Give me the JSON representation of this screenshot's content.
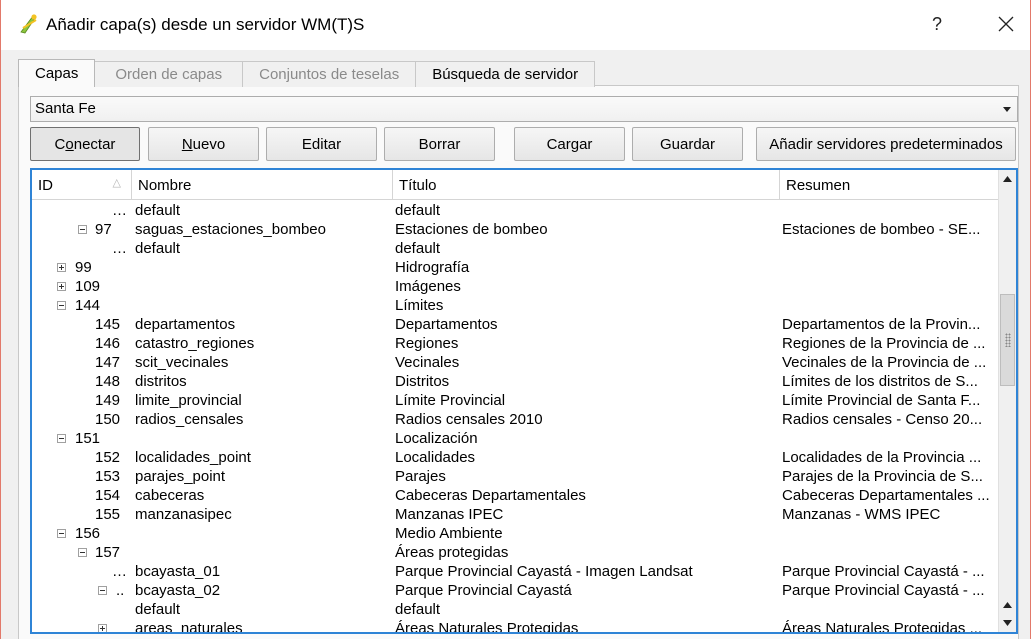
{
  "window": {
    "title": "Añadir capa(s) desde un servidor WM(T)S",
    "help_label": "?"
  },
  "tabs": [
    {
      "label": "Capas",
      "active": true
    },
    {
      "label": "Orden de capas",
      "active": false
    },
    {
      "label": "Conjuntos de teselas",
      "active": false
    },
    {
      "label": "Búsqueda de servidor",
      "active": false
    }
  ],
  "connection": {
    "selected": "Santa Fe"
  },
  "buttons": {
    "connect_pre": "C",
    "connect_u": "o",
    "connect_post": "nectar",
    "new_u": "N",
    "new_post": "uevo",
    "edit": "Editar",
    "delete": "Borrar",
    "load": "Cargar",
    "save": "Guardar",
    "add_defaults": "Añadir servidores predeterminados"
  },
  "table": {
    "columns": [
      "ID",
      "Nombre",
      "Título",
      "Resumen"
    ],
    "sort_indicator": "△",
    "rows": [
      {
        "id": "",
        "name": "default",
        "title": "default",
        "summary": ""
      },
      {
        "id": "97",
        "name": "saguas_estaciones_bombeo",
        "title": "Estaciones de bombeo",
        "summary": "Estaciones de bombeo - SE..."
      },
      {
        "id": "",
        "name": "default",
        "title": "default",
        "summary": ""
      },
      {
        "id": "99",
        "name": "",
        "title": "Hidrografía",
        "summary": ""
      },
      {
        "id": "109",
        "name": "",
        "title": "Imágenes",
        "summary": ""
      },
      {
        "id": "144",
        "name": "",
        "title": "Límites",
        "summary": ""
      },
      {
        "id": "145",
        "name": "departamentos",
        "title": "Departamentos",
        "summary": "Departamentos de la Provin..."
      },
      {
        "id": "146",
        "name": "catastro_regiones",
        "title": "Regiones",
        "summary": "Regiones de la Provincia de ..."
      },
      {
        "id": "147",
        "name": "scit_vecinales",
        "title": "Vecinales",
        "summary": "Vecinales de la Provincia de ..."
      },
      {
        "id": "148",
        "name": "distritos",
        "title": "Distritos",
        "summary": "Límites de los distritos de S..."
      },
      {
        "id": "149",
        "name": "limite_provincial",
        "title": "Límite Provincial",
        "summary": "Límite Provincial de Santa F..."
      },
      {
        "id": "150",
        "name": "radios_censales",
        "title": "Radios censales 2010",
        "summary": "Radios censales - Censo 20..."
      },
      {
        "id": "151",
        "name": "",
        "title": "Localización",
        "summary": ""
      },
      {
        "id": "152",
        "name": "localidades_point",
        "title": "Localidades",
        "summary": "Localidades de la Provincia ..."
      },
      {
        "id": "153",
        "name": "parajes_point",
        "title": "Parajes",
        "summary": "Parajes de la Provincia de S..."
      },
      {
        "id": "154",
        "name": "cabeceras",
        "title": "Cabeceras Departamentales",
        "summary": "Cabeceras Departamentales ..."
      },
      {
        "id": "155",
        "name": "manzanasipec",
        "title": "Manzanas IPEC",
        "summary": "Manzanas - WMS IPEC"
      },
      {
        "id": "156",
        "name": "",
        "title": "Medio Ambiente",
        "summary": ""
      },
      {
        "id": "157",
        "name": "",
        "title": "Áreas protegidas",
        "summary": ""
      },
      {
        "id": "",
        "name": "bcayasta_01",
        "title": "Parque Provincial Cayastá - Imagen Landsat",
        "summary": "Parque Provincial Cayastá - ..."
      },
      {
        "id": "",
        "name": "bcayasta_02",
        "title": "Parque Provincial Cayastá",
        "summary": "Parque Provincial Cayastá - ..."
      },
      {
        "id": "",
        "name": "default",
        "title": "default",
        "summary": ""
      },
      {
        "id": "",
        "name": "areas_naturales",
        "title": "Áreas Naturales Protegidas",
        "summary": "Áreas Naturales Protegidas ..."
      }
    ]
  }
}
